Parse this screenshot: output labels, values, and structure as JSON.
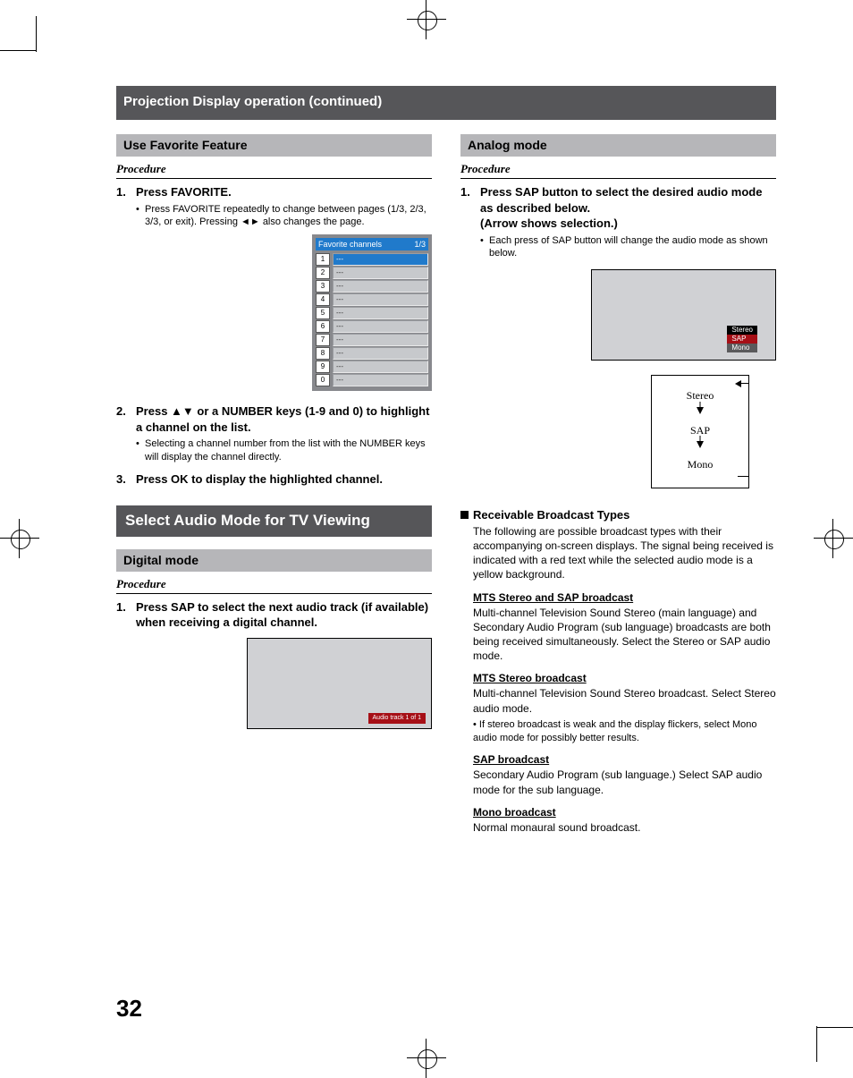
{
  "header": "Projection Display operation (continued)",
  "left": {
    "favorite": {
      "heading": "Use Favorite Feature",
      "procedure_label": "Procedure",
      "steps": [
        {
          "title": "Press FAVORITE.",
          "sub": "Press FAVORITE repeatedly to change between pages (1/3, 2/3, 3/3, or exit). Pressing ◄► also changes the page."
        },
        {
          "title": "Press ▲▼ or a NUMBER keys (1-9 and 0) to highlight a channel on the list.",
          "sub": "Selecting a channel number from the list with the NUMBER keys will display the channel directly."
        },
        {
          "title": "Press OK to display the highlighted channel."
        }
      ],
      "osd": {
        "title": "Favorite channels",
        "page": "1/3",
        "rows": [
          "1",
          "2",
          "3",
          "4",
          "5",
          "6",
          "7",
          "8",
          "9",
          "0"
        ],
        "empty": "---"
      }
    },
    "audio_section_title": "Select Audio Mode for TV Viewing",
    "digital": {
      "heading": "Digital mode",
      "procedure_label": "Procedure",
      "step_title": "Press SAP to select the next audio track (if available) when receiving a digital channel.",
      "osd_badge": "Audio track 1 of 1"
    }
  },
  "right": {
    "analog": {
      "heading": "Analog mode",
      "procedure_label": "Procedure",
      "step_title": "Press SAP button to select the desired audio mode as described below.\n(Arrow shows selection.)",
      "sub": "Each press of SAP button will change the audio mode as shown below.",
      "osd_modes": {
        "stereo": "Stereo",
        "sap": "SAP",
        "mono": "Mono"
      },
      "flow": {
        "stereo": "Stereo",
        "sap": "SAP",
        "mono": "Mono"
      }
    },
    "broadcast": {
      "heading": "Receivable Broadcast Types",
      "intro": "The following are possible broadcast types with their accompanying on-screen displays. The signal being received is indicated with a red text while the selected audio mode is a yellow background.",
      "items": [
        {
          "title": "MTS Stereo and SAP broadcast",
          "text": "Multi-channel Television Sound Stereo (main language) and Secondary Audio Program (sub language) broadcasts are both being received simultaneously. Select the Stereo or SAP audio mode."
        },
        {
          "title": "MTS Stereo broadcast",
          "text": "Multi-channel Television Sound Stereo broadcast. Select Stereo audio mode.",
          "bullet": "If stereo broadcast is weak and the display flickers, select Mono audio mode for possibly better results."
        },
        {
          "title": "SAP broadcast",
          "text": "Secondary Audio Program (sub language.) Select SAP audio mode for the sub language."
        },
        {
          "title": "Mono broadcast",
          "text": "Normal monaural sound broadcast."
        }
      ]
    }
  },
  "page_number": "32"
}
